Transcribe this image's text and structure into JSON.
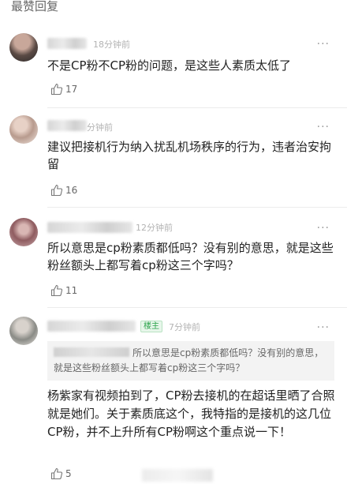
{
  "section": {
    "title": "最赞回复"
  },
  "comments": [
    {
      "time": "18分钟前",
      "text": "不是CP粉不CP粉的问题，是这些人素质太低了",
      "likes": "17"
    },
    {
      "time": "分钟前",
      "text": "建议把接机行为纳入扰乱机场秩序的行为，违者治安拘留",
      "likes": "16"
    },
    {
      "time": "12分钟前",
      "text": "所以意思是cp粉素质都低吗？没有别的意思，就是这些粉丝额头上都写着cp粉这三个字吗？",
      "likes": "11"
    },
    {
      "badge": "楼主",
      "time": "7分钟前",
      "quote": "所以意思是cp粉素质都低吗？没有别的意思，就是这些粉丝额头上都写着cp粉这三个字吗？",
      "text": "杨紫家有视频拍到了，CP粉去接机的在超话里晒了合照就是她们。关于素质底这个，我特指的是接机的这几位CP粉，并不上升所有CP粉啊这个重点说一下！",
      "likes": "5"
    }
  ],
  "more_icon": "···",
  "icons": {
    "like": "thumbs-up-icon",
    "more": "more-dots-icon"
  },
  "colors": {
    "badge_green": "#2aa34a",
    "time_gray": "#b3b3b3",
    "text": "#222222"
  }
}
